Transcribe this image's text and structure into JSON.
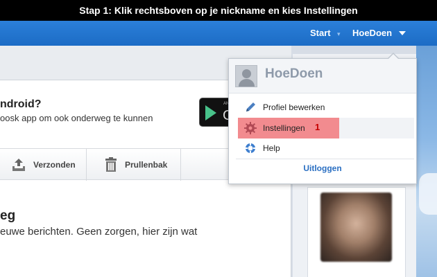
{
  "caption": "Stap 1: Klik rechtsboven op je nickname en kies Instellingen",
  "topnav": {
    "start_label": "Start",
    "user_label": "HoeDoen"
  },
  "promo": {
    "title": "ndroid?",
    "subtitle": "oosk app om ook onderweg te kunnen"
  },
  "toolbar": {
    "sent_label": "Verzonden",
    "trash_label": "Prullenbak"
  },
  "messages": {
    "title": "eg",
    "text": "euwe berichten. Geen zorgen, hier zijn wat"
  },
  "dropdown": {
    "username": "HoeDoen",
    "items": [
      {
        "label": "Profiel bewerken",
        "icon": "pencil-icon"
      },
      {
        "label": "Instellingen",
        "icon": "gear-icon"
      },
      {
        "label": "Help",
        "icon": "lifebuoy-icon"
      }
    ],
    "logout_label": "Uitloggen",
    "step_number": "1"
  },
  "colors": {
    "nav_blue": "#1f74cf",
    "highlight": "#f28b8f",
    "link_blue": "#2a6fc2",
    "step_red": "#c40000"
  }
}
